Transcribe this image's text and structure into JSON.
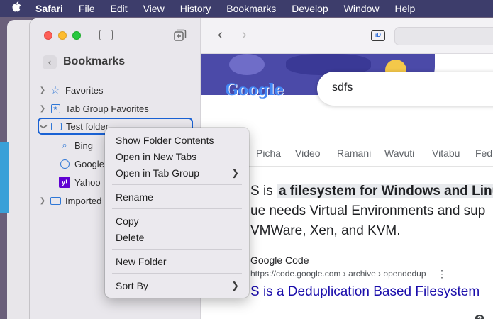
{
  "menubar": {
    "items": [
      "Safari",
      "File",
      "Edit",
      "View",
      "History",
      "Bookmarks",
      "Develop",
      "Window",
      "Help"
    ]
  },
  "sidebar": {
    "title": "Bookmarks",
    "items": [
      {
        "label": "Favorites",
        "icon": "star-icon"
      },
      {
        "label": "Tab Group Favorites",
        "icon": "tab-group-icon"
      },
      {
        "label": "Test folder",
        "icon": "folder-icon",
        "expanded": true,
        "selected": true
      },
      {
        "label": "Bing",
        "icon": "search-icon"
      },
      {
        "label": "Google",
        "icon": "globe-icon"
      },
      {
        "label": "Yahoo",
        "icon": "yahoo-icon"
      },
      {
        "label": "Imported",
        "icon": "folder-icon"
      }
    ]
  },
  "toolbar": {
    "id_badge": "iD"
  },
  "page": {
    "logo": "Google",
    "query": "sdfs",
    "tabs": [
      "Picha",
      "Video",
      "Ramani",
      "Wavuti",
      "Vitabu",
      "Fed"
    ],
    "snippet_line1_pre": "S is ",
    "snippet_line1_hl": "a filesystem for Windows and Linu",
    "snippet_line2": "ue needs Virtual Environments and sup",
    "snippet_line3": "VMWare, Xen, and KVM.",
    "source_name": "Google Code",
    "source_url": "https://code.google.com › archive › opendedup",
    "result_title": "S is a Deduplication Based Filesystem",
    "help_label": "?"
  },
  "context_menu": {
    "show_folder_contents": "Show Folder Contents",
    "open_in_new_tabs": "Open in New Tabs",
    "open_in_tab_group": "Open in Tab Group",
    "rename": "Rename",
    "copy": "Copy",
    "delete": "Delete",
    "new_folder": "New Folder",
    "sort_by": "Sort By"
  },
  "colors": {
    "menubar_bg": "#3d3d6b",
    "accent": "#1a62d4",
    "link": "#1a0dab"
  }
}
